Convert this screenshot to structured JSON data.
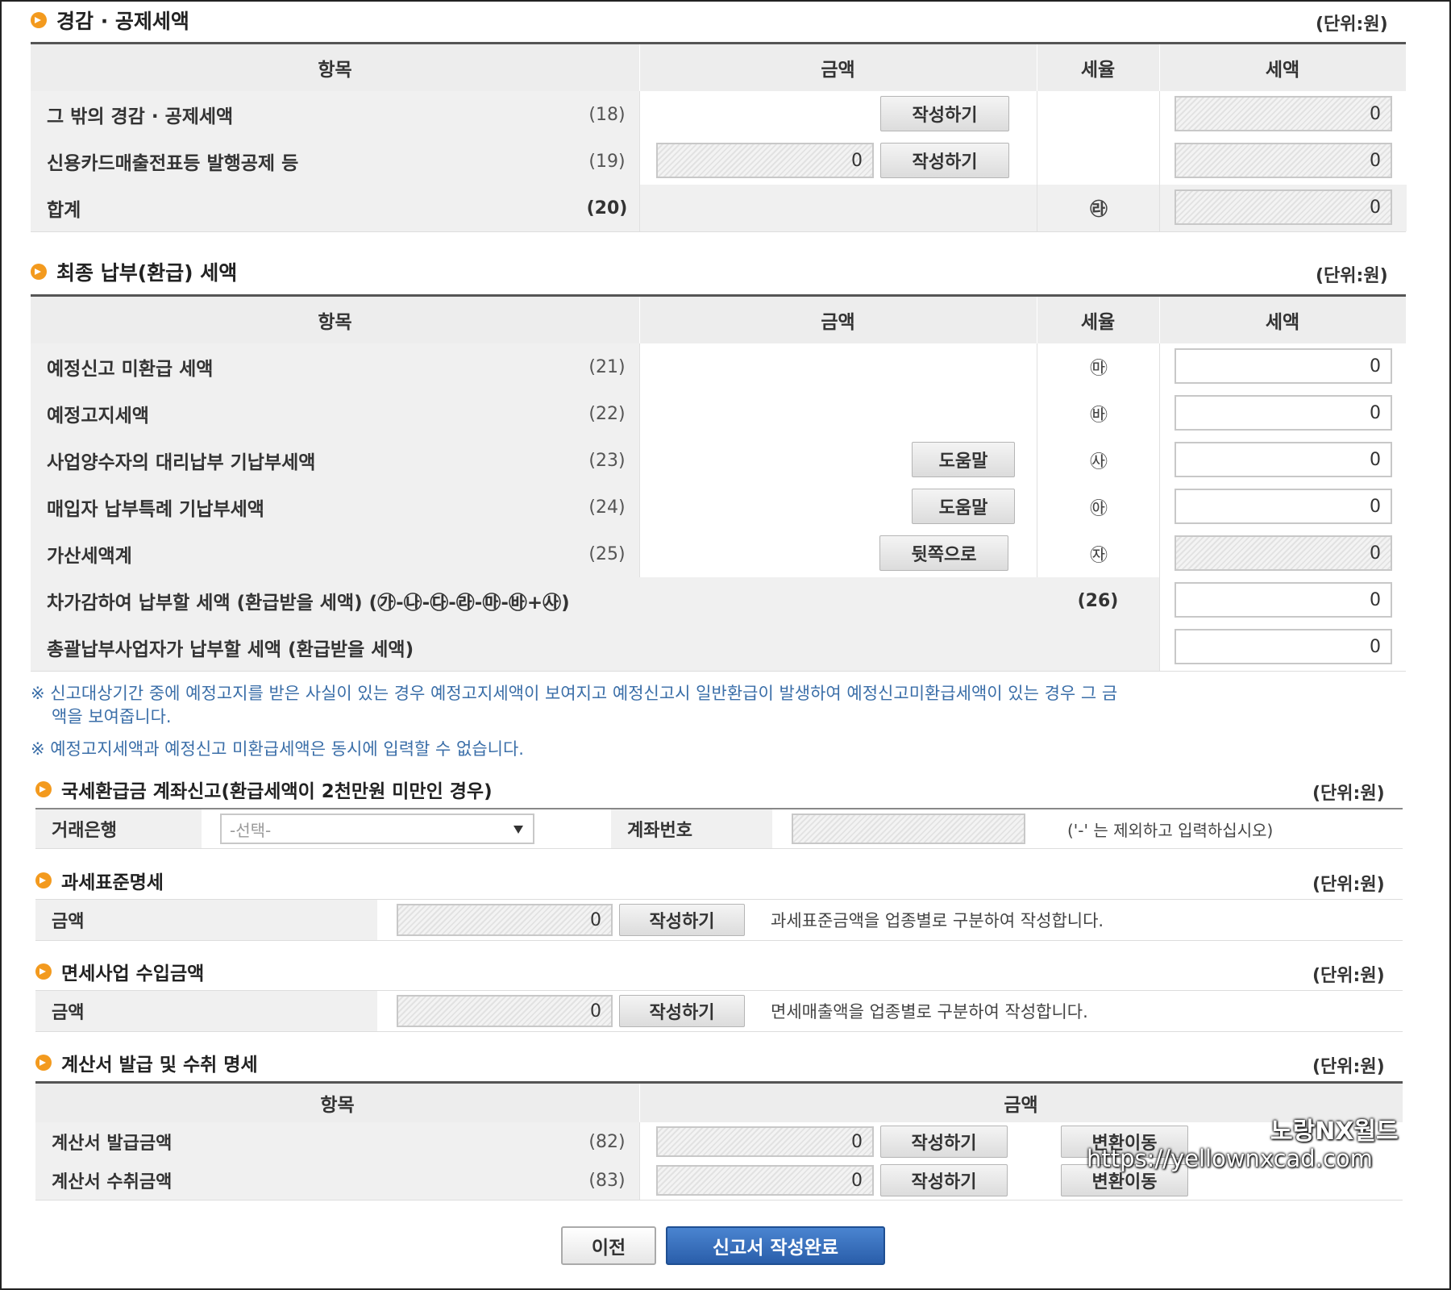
{
  "unit_label": "(단위:원)",
  "sec1": {
    "title": "경감 · 공제세액",
    "headers": [
      "항목",
      "금액",
      "세율",
      "세액"
    ],
    "rows": [
      {
        "label": "그 밖의 경감 · 공제세액",
        "num": "(18)",
        "button": "작성하기",
        "tax": "0"
      },
      {
        "label": "신용카드매출전표등 발행공제 등",
        "num": "(19)",
        "amount": "0",
        "button": "작성하기",
        "tax": "0"
      },
      {
        "label": "합계",
        "num": "(20)",
        "rate": "㉱",
        "tax": "0"
      }
    ]
  },
  "sec2": {
    "title": "최종 납부(환급) 세액",
    "headers": [
      "항목",
      "금액",
      "세율",
      "세액"
    ],
    "rows": [
      {
        "label": "예정신고 미환급 세액",
        "num": "(21)",
        "rate": "㉲",
        "tax": "0"
      },
      {
        "label": "예정고지세액",
        "num": "(22)",
        "rate": "㉳",
        "tax": "0"
      },
      {
        "label": "사업양수자의 대리납부 기납부세액",
        "num": "(23)",
        "button": "도움말",
        "rate": "㉴",
        "tax": "0"
      },
      {
        "label": "매입자 납부특례 기납부세액",
        "num": "(24)",
        "button": "도움말",
        "rate": "㉵",
        "tax": "0"
      },
      {
        "label": "가산세액계",
        "num": "(25)",
        "button": "뒷쪽으로",
        "rate": "㉶",
        "tax": "0"
      },
      {
        "label": "차가감하여 납부할 세액 (환급받을 세액) (㉮-㉯-㉰-㉱-㉲-㉳+㉴)",
        "num": "(26)",
        "tax": "0"
      },
      {
        "label": "총괄납부사업자가 납부할 세액 (환급받을 세액)",
        "tax": "0"
      }
    ],
    "notes": [
      "※ 신고대상기간 중에 예정고지를 받은 사실이 있는 경우 예정고지세액이 보여지고 예정신고시 일반환급이 발생하여 예정신고미환급세액이 있는 경우 그 금",
      "액을 보여줍니다.",
      "※ 예정고지세액과 예정신고 미환급세액은 동시에 입력할 수 없습니다."
    ]
  },
  "sec3": {
    "title": "국세환급금 계좌신고(환급세액이 2천만원 미만인 경우)",
    "bank_label": "거래은행",
    "bank_select": "-선택-",
    "account_label": "계좌번호",
    "account_hint": "('-' 는 제외하고 입력하십시오)"
  },
  "sec4": {
    "title": "과세표준명세",
    "label": "금액",
    "amount": "0",
    "button": "작성하기",
    "desc": "과세표준금액을 업종별로 구분하여 작성합니다."
  },
  "sec5": {
    "title": "면세사업 수입금액",
    "label": "금액",
    "amount": "0",
    "button": "작성하기",
    "desc": "면세매출액을 업종별로 구분하여 작성합니다."
  },
  "sec6": {
    "title": "계산서 발급 및 수취 명세",
    "headers": [
      "항목",
      "금액"
    ],
    "rows": [
      {
        "label": "계산서 발급금액",
        "num": "(82)",
        "amount": "0",
        "button": "작성하기",
        "button2": "변환이동"
      },
      {
        "label": "계산서 수취금액",
        "num": "(83)",
        "amount": "0",
        "button": "작성하기",
        "button2": "변환이동"
      }
    ]
  },
  "footer": {
    "prev": "이전",
    "submit": "신고서 작성완료"
  },
  "watermark": {
    "line1": "노랑NX월드",
    "line2": "https://yellownxcad.com"
  },
  "colors": {
    "bullet": "#f39a1e",
    "note": "#3a6ea8",
    "submit": "#2f66b3"
  }
}
